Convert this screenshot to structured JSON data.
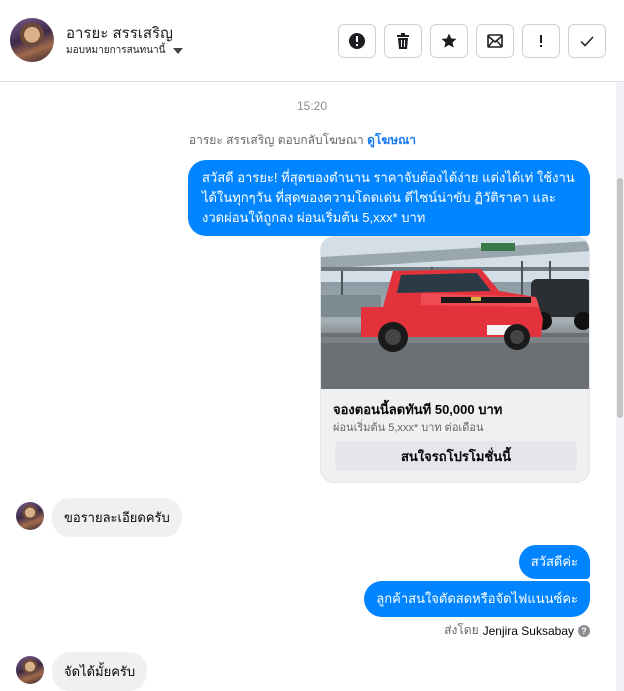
{
  "header": {
    "contact_name": "อารยะ สรรเสริญ",
    "assign_label": "มอบหมายการสนทนานี้",
    "tools": [
      {
        "icon": "alert-circle-icon"
      },
      {
        "icon": "trash-icon"
      },
      {
        "icon": "star-icon"
      },
      {
        "icon": "mark-unread-icon"
      },
      {
        "icon": "exclamation-icon"
      },
      {
        "icon": "checkmark-icon"
      }
    ]
  },
  "conversation": {
    "timestamp": "15:20",
    "reply_note": {
      "text": "อารยะ สรรเสริญ ตอบกลับโฆษณา ",
      "link": "ดูโฆษณา"
    },
    "ad_message": "สวัสดี อารยะ! ที่สุดของตำนาน ราคาจับต้องได้ง่าย แต่งได้เท่ ใช้งานได้ในทุกๆวัน ที่สุดของความโดดเด่น ดีไซน์น่าขับ ฏิวัติราคา และงวดผ่อนให้ถูกลง ผ่อนเริ่มต้น 5,xxx* บาท",
    "ad_card": {
      "title": "จองตอนนี้ลดทันที 50,000 บาท",
      "subtitle": "ผ่อนเริ่มต้น 5,xxx* บาท ต่อเดือน",
      "cta": "สนใจรถโปรโมชั่นนี้"
    },
    "messages": [
      {
        "direction": "in",
        "text": "ขอรายละเอียดครับ"
      },
      {
        "direction": "out",
        "text": "สวัสดีค่ะ"
      },
      {
        "direction": "out",
        "text": "ลูกค้าสนใจตัดสดหรือจัดไฟแนนซ์คะ"
      },
      {
        "direction": "in",
        "text": "จัดได้มั้ยครับ"
      }
    ],
    "sent_by_label": "ส่งโดย",
    "sent_by_agent": "Jenjira Suksabay",
    "help_glyph": "?"
  },
  "colors": {
    "outgoing_bubble": "#0084ff",
    "incoming_bubble": "#f0f0f0",
    "link": "#1877f2",
    "car": "#e2323c"
  }
}
